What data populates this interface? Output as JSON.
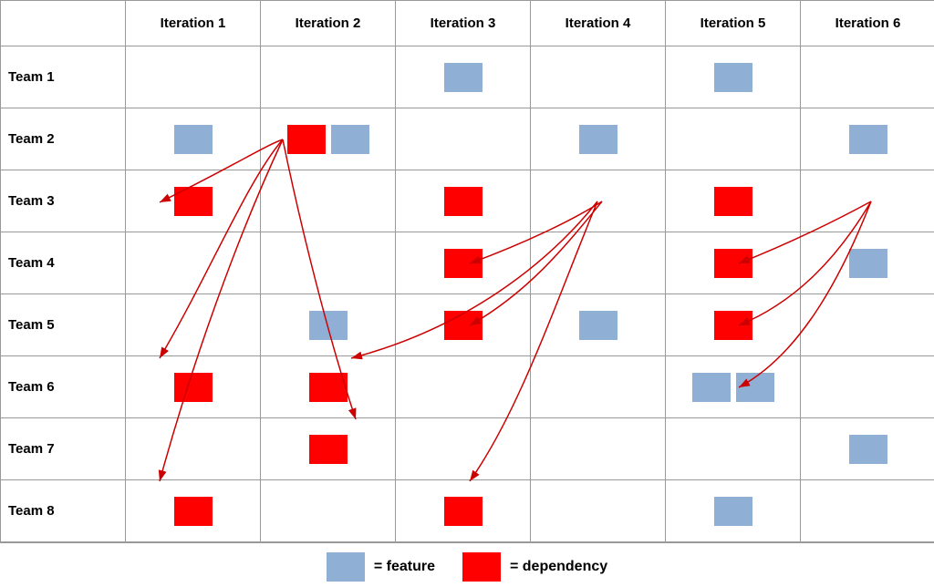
{
  "header": {
    "col0": "",
    "iterations": [
      "Iteration 1",
      "Iteration 2",
      "Iteration 3",
      "Iteration 4",
      "Iteration 5",
      "Iteration 6"
    ]
  },
  "teams": [
    {
      "label": "Team 1"
    },
    {
      "label": "Team 2"
    },
    {
      "label": "Team 3"
    },
    {
      "label": "Team 4"
    },
    {
      "label": "Team 5"
    },
    {
      "label": "Team 6"
    },
    {
      "label": "Team 7"
    },
    {
      "label": "Team 8"
    }
  ],
  "legend": {
    "feature_label": "= feature",
    "dependency_label": "= dependency"
  }
}
